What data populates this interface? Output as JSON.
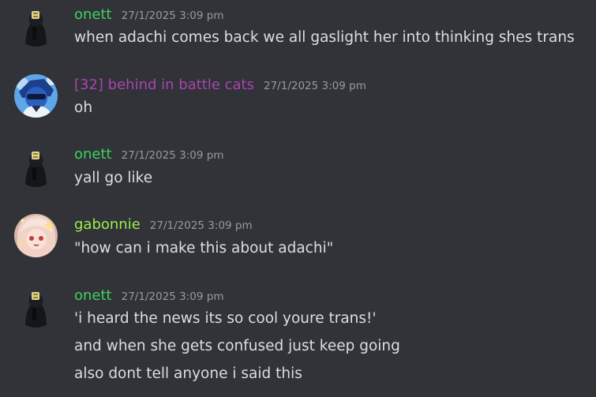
{
  "colors": {
    "background": "#313338",
    "text": "#dbdee1",
    "timestamp": "#949ba4",
    "onett": "#3ed15d",
    "battlecats": "#a845b2",
    "gabonnie": "#9ded4d"
  },
  "messages": [
    {
      "username": "onett",
      "timestamp": "27/1/2025 3:09 pm",
      "avatar": "dark-figure-avatar",
      "lines": [
        "when adachi comes back we all gaslight her into thinking shes trans"
      ]
    },
    {
      "username": "[32] behind in battle cats",
      "timestamp": "27/1/2025 3:09 pm",
      "avatar": "blue-character-avatar",
      "lines": [
        "oh"
      ]
    },
    {
      "username": "onett",
      "timestamp": "27/1/2025 3:09 pm",
      "avatar": "dark-figure-avatar",
      "lines": [
        "yall go like"
      ]
    },
    {
      "username": "gabonnie",
      "timestamp": "27/1/2025 3:09 pm",
      "avatar": "anime-girl-avatar",
      "lines": [
        "\"how can i make this about adachi\""
      ]
    },
    {
      "username": "onett",
      "timestamp": "27/1/2025 3:09 pm",
      "avatar": "dark-figure-avatar",
      "lines": [
        "'i heard the news its so cool youre trans!'",
        "and when she gets confused just keep going",
        "also dont tell anyone i said this"
      ]
    }
  ]
}
